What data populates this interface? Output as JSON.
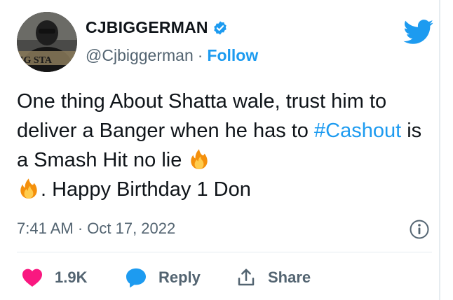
{
  "author": {
    "display_name": "CJBIGGERMAN",
    "handle": "@Cjbiggerman",
    "separator": "·",
    "follow_label": "Follow",
    "avatar_text": "IG STA"
  },
  "tweet": {
    "text_part1": "One thing About Shatta wale, trust him to deliver a Banger when he has to ",
    "hashtag": "#Cashout",
    "text_part2": " is a Smash Hit no lie ",
    "text_part3": ". Happy Birthday 1 Don",
    "emoji": "fire-icon"
  },
  "meta": {
    "time": "7:41 AM · Oct 17, 2022"
  },
  "actions": {
    "like_count": "1.9K",
    "reply_label": "Reply",
    "share_label": "Share"
  },
  "colors": {
    "accent": "#1d9bf0",
    "like": "#f91880",
    "text": "#0f1419",
    "secondary": "#536471"
  }
}
